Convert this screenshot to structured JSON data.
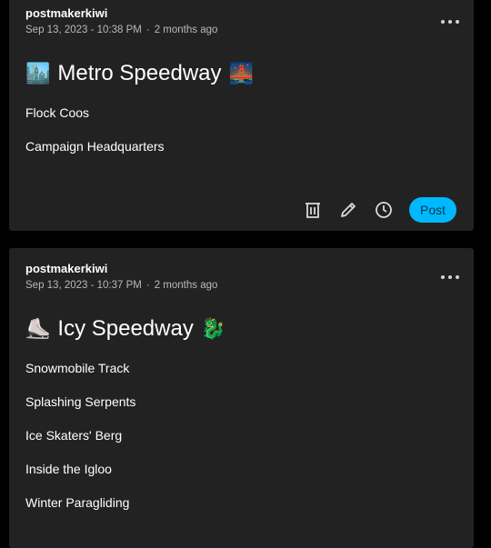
{
  "posts": [
    {
      "username": "postmakerkiwi",
      "date": "Sep 13, 2023 - 10:38 PM",
      "relative": "2 months ago",
      "title": "Metro Speedway",
      "emoji_left": "🏙️",
      "emoji_right": "🌉",
      "items": [
        "Flock Coos",
        "Campaign Headquarters"
      ],
      "actions": {
        "icons": [
          "trash-icon",
          "pencil-icon",
          "clock-icon"
        ],
        "post_label": "Post"
      }
    },
    {
      "username": "postmakerkiwi",
      "date": "Sep 13, 2023 - 10:37 PM",
      "relative": "2 months ago",
      "title": "Icy Speedway",
      "emoji_left": "⛸️",
      "emoji_right": "🐉",
      "items": [
        "Snowmobile Track",
        "Splashing Serpents",
        "Ice Skaters' Berg",
        "Inside the Igloo",
        "Winter Paragliding"
      ]
    }
  ],
  "colors": {
    "background": "#000000",
    "card": "#222222",
    "accent": "#00b8ff",
    "meta_text": "#b9b9b9"
  }
}
